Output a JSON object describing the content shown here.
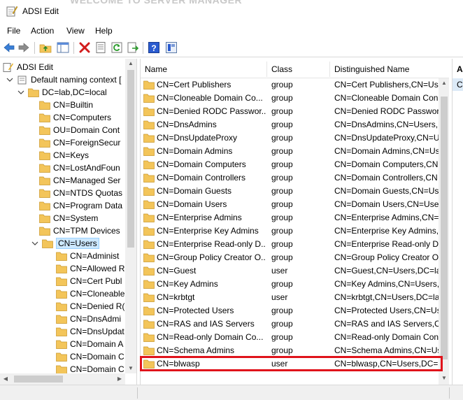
{
  "window": {
    "title": "ADSI Edit",
    "background_title": "WELCOME TO SERVER MANAGER"
  },
  "menu": [
    "File",
    "Action",
    "View",
    "Help"
  ],
  "toolbar": {
    "icons": [
      "back-icon",
      "forward-icon",
      "up-folder-icon",
      "show-hide-tree-icon",
      "delete-icon",
      "properties-icon",
      "refresh-icon",
      "export-list-icon",
      "help-icon",
      "mmc-help-icon"
    ]
  },
  "tree": {
    "root": "ADSI Edit",
    "context": "Default naming context [",
    "domain": "DC=lab,DC=local",
    "level1": [
      "CN=Builtin",
      "CN=Computers",
      "OU=Domain Cont",
      "CN=ForeignSecur",
      "CN=Keys",
      "CN=LostAndFoun",
      "CN=Managed Ser",
      "CN=NTDS Quotas",
      "CN=Program Data",
      "CN=System",
      "CN=TPM Devices",
      "CN=Users"
    ],
    "users_children": [
      "CN=Administ",
      "CN=Allowed R",
      "CN=Cert Publ",
      "CN=Cloneable",
      "CN=Denied R(",
      "CN=DnsAdmi",
      "CN=DnsUpdat",
      "CN=Domain A",
      "CN=Domain C",
      "CN=Domain C"
    ]
  },
  "list": {
    "headers": {
      "name": "Name",
      "class": "Class",
      "dn": "Distinguished Name"
    },
    "rows": [
      {
        "name": "CN=Cert Publishers",
        "class": "group",
        "dn": "CN=Cert Publishers,CN=Use"
      },
      {
        "name": "CN=Cloneable Domain Co...",
        "class": "group",
        "dn": "CN=Cloneable Domain Con"
      },
      {
        "name": "CN=Denied RODC Passwor...",
        "class": "group",
        "dn": "CN=Denied RODC Password"
      },
      {
        "name": "CN=DnsAdmins",
        "class": "group",
        "dn": "CN=DnsAdmins,CN=Users,D"
      },
      {
        "name": "CN=DnsUpdateProxy",
        "class": "group",
        "dn": "CN=DnsUpdateProxy,CN=Us"
      },
      {
        "name": "CN=Domain Admins",
        "class": "group",
        "dn": "CN=Domain Admins,CN=Use"
      },
      {
        "name": "CN=Domain Computers",
        "class": "group",
        "dn": "CN=Domain Computers,CN"
      },
      {
        "name": "CN=Domain Controllers",
        "class": "group",
        "dn": "CN=Domain Controllers,CN"
      },
      {
        "name": "CN=Domain Guests",
        "class": "group",
        "dn": "CN=Domain Guests,CN=Use"
      },
      {
        "name": "CN=Domain Users",
        "class": "group",
        "dn": "CN=Domain Users,CN=Use"
      },
      {
        "name": "CN=Enterprise Admins",
        "class": "group",
        "dn": "CN=Enterprise Admins,CN="
      },
      {
        "name": "CN=Enterprise Key Admins",
        "class": "group",
        "dn": "CN=Enterprise Key Admins,C"
      },
      {
        "name": "CN=Enterprise Read-only D...",
        "class": "group",
        "dn": "CN=Enterprise Read-only Do"
      },
      {
        "name": "CN=Group Policy Creator O...",
        "class": "group",
        "dn": "CN=Group Policy Creator Ov"
      },
      {
        "name": "CN=Guest",
        "class": "user",
        "dn": "CN=Guest,CN=Users,DC=lab"
      },
      {
        "name": "CN=Key Admins",
        "class": "group",
        "dn": "CN=Key Admins,CN=Users,D"
      },
      {
        "name": "CN=krbtgt",
        "class": "user",
        "dn": "CN=krbtgt,CN=Users,DC=la"
      },
      {
        "name": "CN=Protected Users",
        "class": "group",
        "dn": "CN=Protected Users,CN=Us"
      },
      {
        "name": "CN=RAS and IAS Servers",
        "class": "group",
        "dn": "CN=RAS and IAS Servers,CN"
      },
      {
        "name": "CN=Read-only Domain Co...",
        "class": "group",
        "dn": "CN=Read-only Domain Con"
      },
      {
        "name": "CN=Schema Admins",
        "class": "group",
        "dn": "CN=Schema Admins,CN=Use"
      },
      {
        "name": "CN=blwasp",
        "class": "user",
        "dn": "CN=blwasp,CN=Users,DC=l"
      }
    ]
  },
  "actions": {
    "header": "A",
    "item": "C"
  },
  "colors": {
    "highlight_border": "#e0131b",
    "selection": "#cce8ff",
    "folder": "#f3c55a"
  }
}
